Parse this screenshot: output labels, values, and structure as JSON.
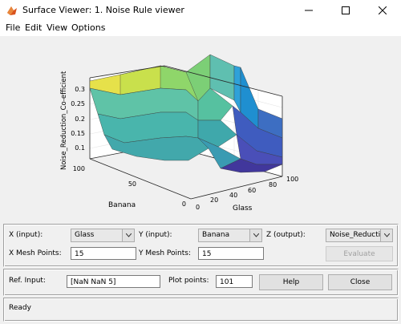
{
  "window": {
    "title": "Surface Viewer: 1. Noise Rule viewer"
  },
  "menu": [
    "File",
    "Edit",
    "View",
    "Options"
  ],
  "plot": {
    "zlabel": "Noise_Reduction_Co-efficient",
    "xlabel": "Glass",
    "ylabel": "Banana",
    "z_ticks": [
      "0.1",
      "0.15",
      "0.2",
      "0.25",
      "0.3"
    ],
    "x_ticks": [
      "0",
      "20",
      "40",
      "60",
      "80",
      "100"
    ],
    "y_ticks": [
      "100",
      "50",
      "0"
    ]
  },
  "controls": {
    "x_input_label": "X (input):",
    "x_input_value": "Glass",
    "y_input_label": "Y (input):",
    "y_input_value": "Banana",
    "z_output_label": "Z (output):",
    "z_output_value": "Noise_Reducti...",
    "x_mesh_label": "X Mesh Points:",
    "x_mesh_value": "15",
    "y_mesh_label": "Y Mesh Points:",
    "y_mesh_value": "15",
    "evaluate_label": "Evaluate",
    "ref_input_label": "Ref. Input:",
    "ref_input_value": "[NaN NaN 5]",
    "plot_points_label": "Plot points:",
    "plot_points_value": "101",
    "help_label": "Help",
    "close_label": "Close"
  },
  "status": {
    "text": "Ready"
  }
}
